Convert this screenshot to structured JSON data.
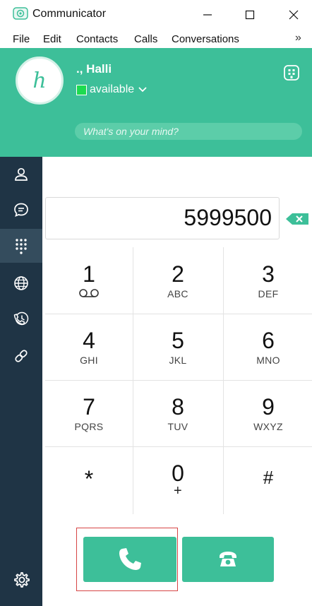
{
  "window": {
    "title": "Communicator",
    "icons": [
      "app-icon",
      "minimize-icon",
      "maximize-icon",
      "close-icon"
    ]
  },
  "menu": {
    "items": [
      "File",
      "Edit",
      "Contacts",
      "Calls",
      "Conversations"
    ],
    "more": "»"
  },
  "profile": {
    "avatar_letter": "h",
    "name": "., Halli",
    "status": "available",
    "status_color": "#1ddb4f",
    "mood_placeholder": "What's on your mind?"
  },
  "colors": {
    "accent": "#3dbf99",
    "sidebar": "#1f3445",
    "sidebar_active": "#344c5d",
    "highlight": "#d64545"
  },
  "sidebar": {
    "items": [
      {
        "icon": "contacts-icon",
        "active": false
      },
      {
        "icon": "chat-icon",
        "active": false
      },
      {
        "icon": "dialpad-icon",
        "active": true
      },
      {
        "icon": "globe-icon",
        "active": false
      },
      {
        "icon": "call-history-icon",
        "active": false
      },
      {
        "icon": "link-icon",
        "active": false
      }
    ],
    "bottom_icon": "settings-icon"
  },
  "dialer": {
    "number": "5999500",
    "keys": [
      {
        "digit": "1",
        "letters": ""
      },
      {
        "digit": "2",
        "letters": "ABC"
      },
      {
        "digit": "3",
        "letters": "DEF"
      },
      {
        "digit": "4",
        "letters": "GHI"
      },
      {
        "digit": "5",
        "letters": "JKL"
      },
      {
        "digit": "6",
        "letters": "MNO"
      },
      {
        "digit": "7",
        "letters": "PQRS"
      },
      {
        "digit": "8",
        "letters": "TUV"
      },
      {
        "digit": "9",
        "letters": "WXYZ"
      },
      {
        "digit": "*",
        "letters": ""
      },
      {
        "digit": "0",
        "letters": "+"
      },
      {
        "digit": "#",
        "letters": ""
      }
    ]
  }
}
